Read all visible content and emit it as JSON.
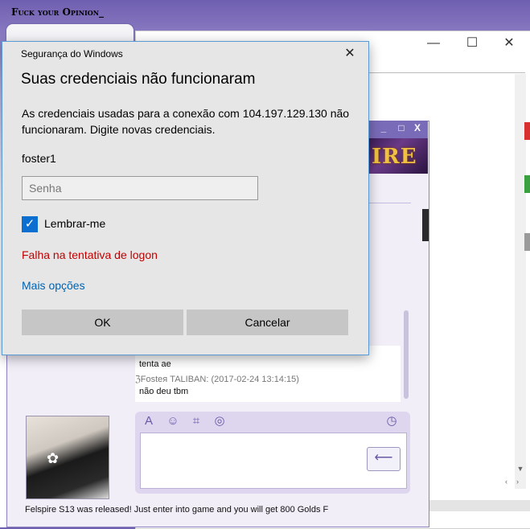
{
  "browser_tab": {
    "label": "Fuck your Opinion_"
  },
  "background_window": {
    "title": "",
    "controls": {
      "minimize": "—",
      "maximize": "☐",
      "close": "✕"
    }
  },
  "chat": {
    "banner_text": "IRE",
    "controls": {
      "minimize": "_",
      "maximize": "□",
      "close": "X"
    },
    "messages": [
      {
        "text": "tenta ae"
      },
      {
        "meta": "ℨFosteя TALIBAN: (2017-02-24 13:14:15)"
      },
      {
        "text": "não deu tbm"
      }
    ],
    "footer": "Felspire S13 was released! Just enter into game and you will get 800 Golds F"
  },
  "dialog": {
    "window_title": "Segurança do Windows",
    "heading": "Suas credenciais não funcionaram",
    "body": "As credenciais usadas para a conexão com 104.197.129.130 não funcionaram. Digite novas credenciais.",
    "username": "foster1",
    "password_placeholder": "Senha",
    "remember_label": "Lembrar-me",
    "remember_checked": true,
    "error": "Falha na tentativa de logon",
    "more_options": "Mais opções",
    "ok_label": "OK",
    "cancel_label": "Cancelar",
    "colors": {
      "accent": "#0b6fd1",
      "error": "#c00000",
      "link": "#0063b1"
    }
  }
}
